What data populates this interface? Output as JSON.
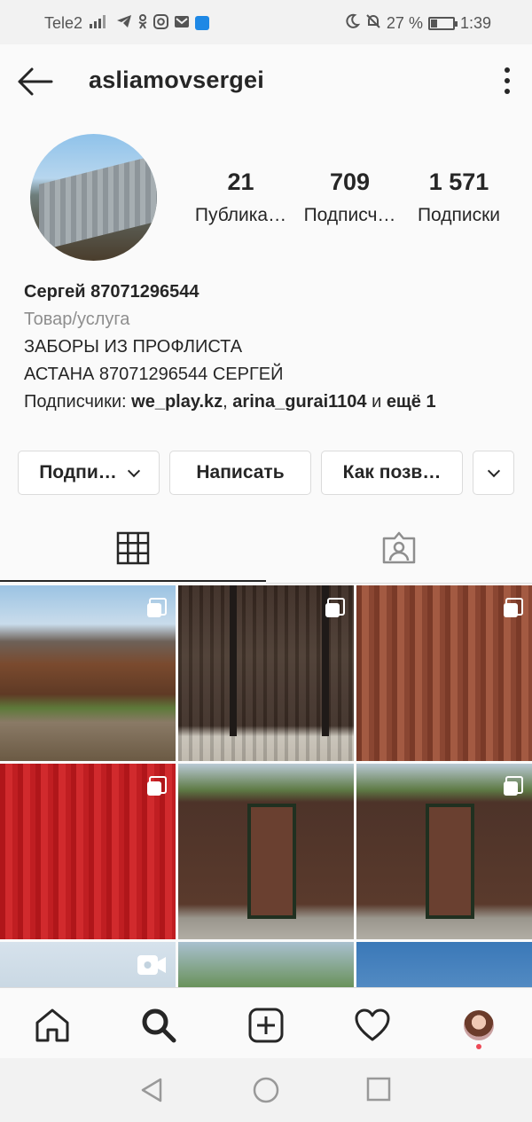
{
  "status_bar": {
    "carrier": "Tele2",
    "battery": "27 %",
    "battery_level": 0.27,
    "time": "1:39"
  },
  "header": {
    "username": "asliamovsergei"
  },
  "profile": {
    "stats": [
      {
        "value": "21",
        "label": "Публика…"
      },
      {
        "value": "709",
        "label": "Подписч…"
      },
      {
        "value": "1 571",
        "label": "Подписки"
      }
    ],
    "bio": {
      "name": "Сергей 87071296544",
      "category": "Товар/услуга",
      "line1": "ЗАБОРЫ ИЗ ПРОФЛИСТА",
      "line2": "АСТАНА 87071296544 СЕРГЕЙ",
      "followers_prefix": "Подписчики: ",
      "follower1": "we_play.kz",
      "sep": ", ",
      "follower2": "arina_gurai1104",
      "and": " и ",
      "more": "ещё 1"
    }
  },
  "actions": {
    "subscribe": "Подпи…",
    "message": "Написать",
    "call": "Как позв…"
  },
  "tabs": [
    {
      "name": "grid",
      "icon": "grid-icon",
      "active": true
    },
    {
      "name": "tagged",
      "icon": "tagged-user-icon",
      "active": false
    }
  ],
  "posts": [
    {
      "icon": "multiple-photos-icon"
    },
    {
      "icon": "multiple-photos-icon"
    },
    {
      "icon": "multiple-photos-icon"
    },
    {
      "icon": "multiple-photos-icon"
    },
    {
      "icon": "none"
    },
    {
      "icon": "multiple-photos-icon"
    },
    {
      "icon": "video-icon"
    },
    {
      "icon": "none"
    },
    {
      "icon": "none"
    }
  ],
  "bottom_nav": [
    "home-icon",
    "search-icon",
    "new-post-icon",
    "activity-heart-icon",
    "profile-avatar"
  ],
  "colors": {
    "text": "#262626",
    "muted": "#8e8e8e",
    "border": "#dbdbdb",
    "notification_dot": "#ed4956"
  }
}
